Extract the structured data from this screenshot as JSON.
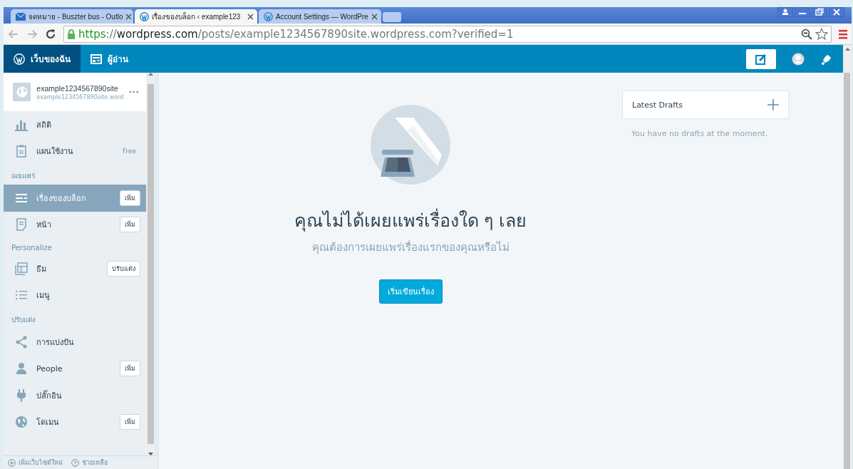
{
  "browser": {
    "tabs": [
      {
        "title": "จดหมาย - Buszter bus - Outlo",
        "kind": "mail",
        "selected": false
      },
      {
        "title": "เรื่องของบล็อก ‹ example123",
        "kind": "wp",
        "selected": true
      },
      {
        "title": "Account Settings — WordPre",
        "kind": "wp",
        "selected": false
      }
    ],
    "url": [
      {
        "text": "https",
        "kind": "secure"
      },
      {
        "text": "://",
        "kind": "dim"
      },
      {
        "text": "wordpress.com",
        "kind": "host"
      },
      {
        "text": "/posts/example1234567890site.wordpress.com?verified=1",
        "kind": "dim"
      }
    ]
  },
  "masterbar": {
    "items": [
      {
        "label": "เว็บของฉัน",
        "kind": "wp",
        "selected": true
      },
      {
        "label": "ผู้อ่าน",
        "kind": "reader",
        "selected": false
      }
    ]
  },
  "sidebar": {
    "site": {
      "title": "example1234567890site",
      "url": "example1234567890site.word"
    },
    "groups": [
      {
        "items": [
          {
            "label": "สถิติ",
            "kind": "stats"
          },
          {
            "label": "แผนใช้งาน",
            "kind": "plan",
            "badge": "Free"
          }
        ]
      },
      {
        "heading": "เผยแพร่",
        "items": [
          {
            "label": "เรื่องของบล็อก",
            "kind": "posts",
            "button": "เพิ่ม",
            "selected": true
          },
          {
            "label": "หน้า",
            "kind": "page",
            "button": "เพิ่ม",
            "selected": false
          }
        ]
      },
      {
        "heading": "Personalize",
        "items": [
          {
            "label": "ธีม",
            "kind": "themes",
            "button": "ปรับแต่ง"
          },
          {
            "label": "เมนู",
            "kind": "menus"
          }
        ]
      },
      {
        "heading": "ปรับแต่ง",
        "items": [
          {
            "label": "การแบ่งปัน",
            "kind": "share"
          },
          {
            "label": "People",
            "kind": "people",
            "button": "เพิ่ม"
          },
          {
            "label": "ปลั๊กอิน",
            "kind": "plugin"
          },
          {
            "label": "โดเมน",
            "kind": "globe",
            "button": "เพิ่ม"
          }
        ]
      }
    ],
    "footer": [
      {
        "label": "เพิ่มเว็บไซต์ใหม่",
        "kind": "add"
      },
      {
        "label": "ช่วยเหลือ",
        "kind": "help"
      }
    ]
  },
  "empty_state": {
    "title": "คุณไม่ได้เผยแพร่เรื่องใด ๆ เลย",
    "subtitle": "คุณต้องการเผยแพร่เรื่องแรกของคุณหรือไม่",
    "button": "เริ่มเขียนเรื่อง"
  },
  "drafts": {
    "title": "Latest Drafts",
    "empty": "You have no drafts at the moment."
  }
}
